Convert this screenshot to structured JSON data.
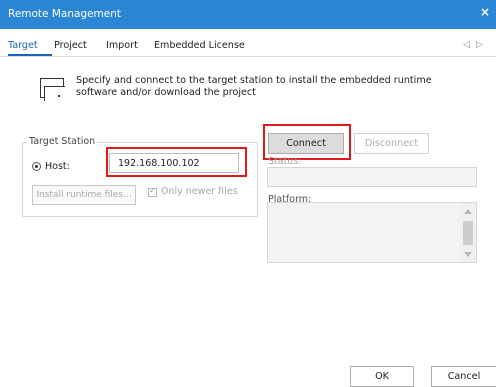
{
  "window": {
    "title": "Remote Management",
    "close_glyph": "×",
    "title_bar_color": "#2b87d3"
  },
  "tabs": [
    {
      "label": "Target",
      "active": true
    },
    {
      "label": "Project",
      "active": false
    },
    {
      "label": "Import",
      "active": false
    },
    {
      "label": "Embedded License",
      "active": false
    }
  ],
  "tab_nav": {
    "prev": "◁",
    "next": "▷"
  },
  "description": "Specify and connect to the target station to install the embedded runtime software and/or download the project",
  "target_station": {
    "label": "Target Station",
    "host_label": "Host:",
    "host_value": "192.168.100.102",
    "host_selected": true,
    "install_button": "Install runtime files...",
    "only_newer_label": "Only newer files",
    "only_newer_checked": true
  },
  "connection": {
    "connect_label": "Connect",
    "disconnect_label": "Disconnect",
    "status_label": "Status:",
    "status_value": "",
    "platform_label": "Platform:",
    "platform_value": ""
  },
  "footer": {
    "ok_label": "OK",
    "cancel_label": "Cancel"
  },
  "highlight_color": "#e01818"
}
